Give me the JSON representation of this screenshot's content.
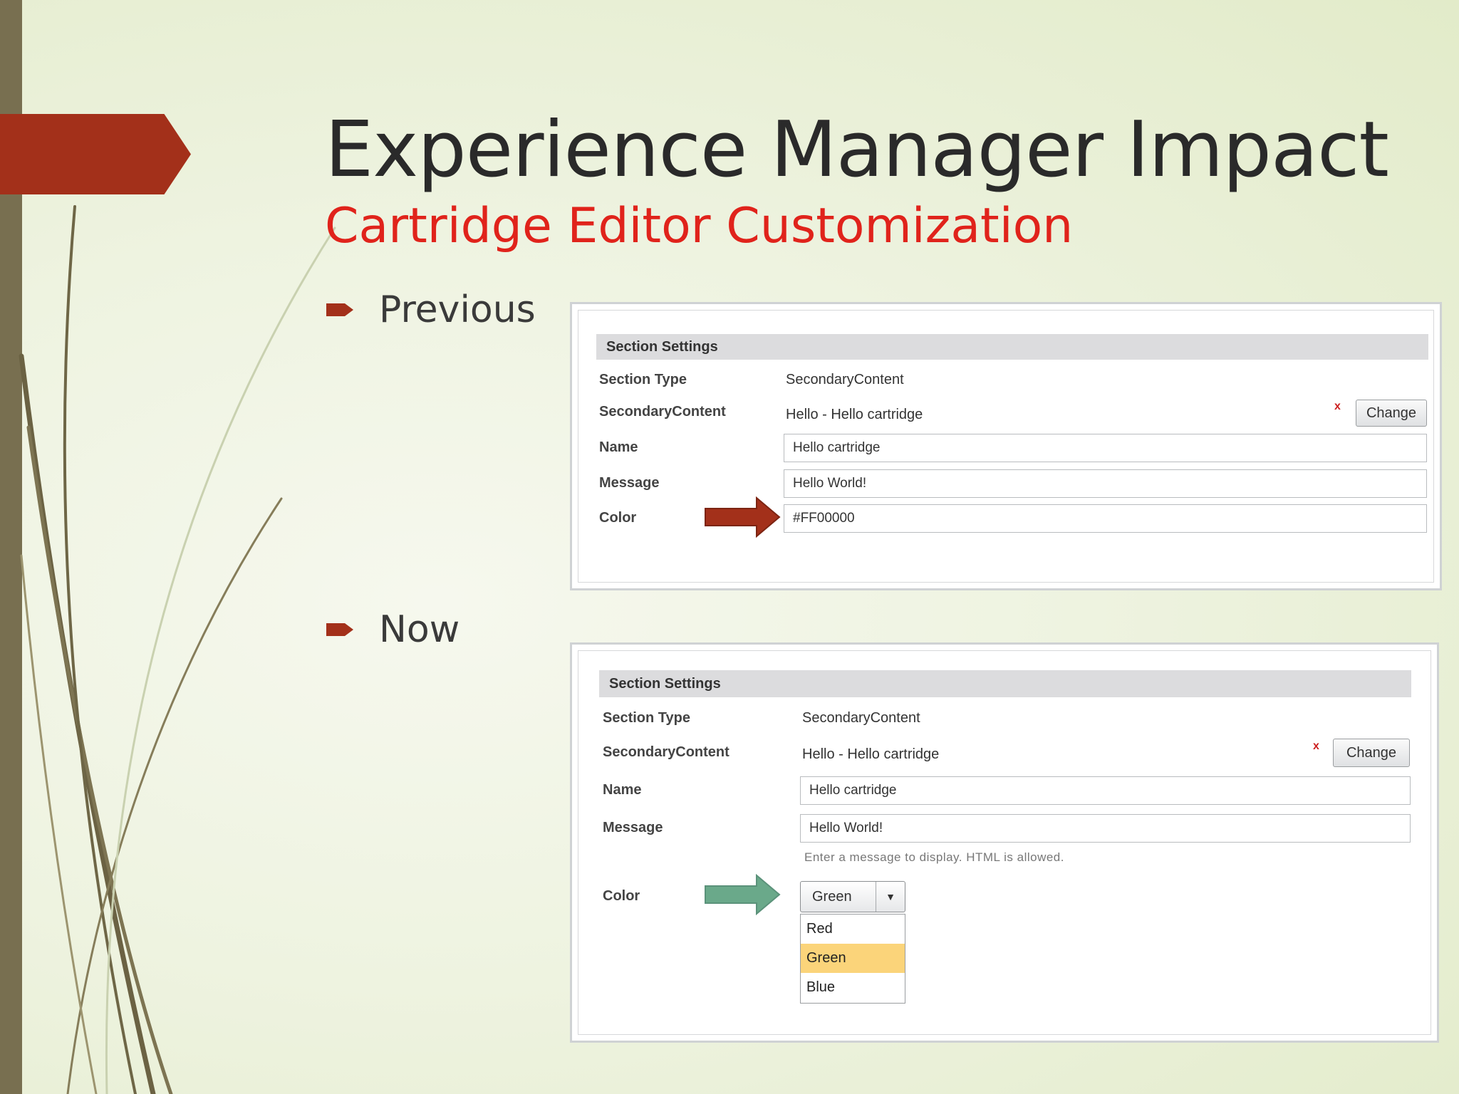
{
  "slide": {
    "title": "Experience Manager Impact",
    "subtitle": "Cartridge Editor Customization",
    "accent_color": "#a3301a",
    "subtitle_color": "#e0231b"
  },
  "bullets": [
    {
      "label": "Previous"
    },
    {
      "label": "Now"
    }
  ],
  "previous": {
    "header": "Section Settings",
    "rows": [
      {
        "label": "Section Type",
        "value": "SecondaryContent"
      },
      {
        "label": "SecondaryContent",
        "value": "Hello - Hello cartridge"
      },
      {
        "label": "Name",
        "value": "Hello cartridge"
      },
      {
        "label": "Message",
        "value": "Hello World!"
      },
      {
        "label": "Color",
        "value": "#FF00000"
      }
    ],
    "remove_label": "x",
    "change_label": "Change",
    "arrow_color": "#a3301a"
  },
  "now": {
    "header": "Section Settings",
    "rows": [
      {
        "label": "Section Type",
        "value": "SecondaryContent"
      },
      {
        "label": "SecondaryContent",
        "value": "Hello - Hello cartridge"
      },
      {
        "label": "Name",
        "value": "Hello cartridge"
      },
      {
        "label": "Message",
        "value": "Hello World!"
      },
      {
        "label": "Color"
      }
    ],
    "message_hint": "Enter a message to display. HTML is allowed.",
    "remove_label": "x",
    "change_label": "Change",
    "select_value": "Green",
    "select_arrow": "▼",
    "options": [
      "Red",
      "Green",
      "Blue"
    ],
    "selected_option": "Green",
    "highlight_color": "#fbd47a",
    "arrow_color": "#6aa98a"
  }
}
